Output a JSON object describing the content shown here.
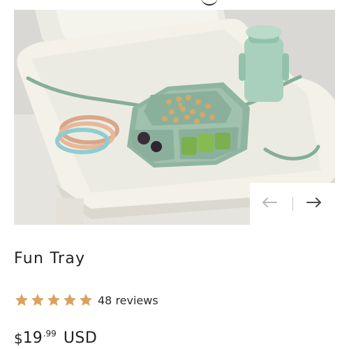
{
  "product": {
    "title": "Fun Tray",
    "rating": 5,
    "rating_max": 5,
    "reviews_label": "48 reviews",
    "price": {
      "currency_symbol": "$",
      "whole": "19",
      "cents": ".99",
      "currency_code": "USD"
    }
  },
  "gallery": {
    "prev_icon": "arrow-left-icon",
    "next_icon": "arrow-right-icon"
  },
  "colors": {
    "star": "#D9A25E",
    "tray_green": "#8FB5A0",
    "highchair": "#F1EFE6",
    "text": "#1F1F1F"
  }
}
